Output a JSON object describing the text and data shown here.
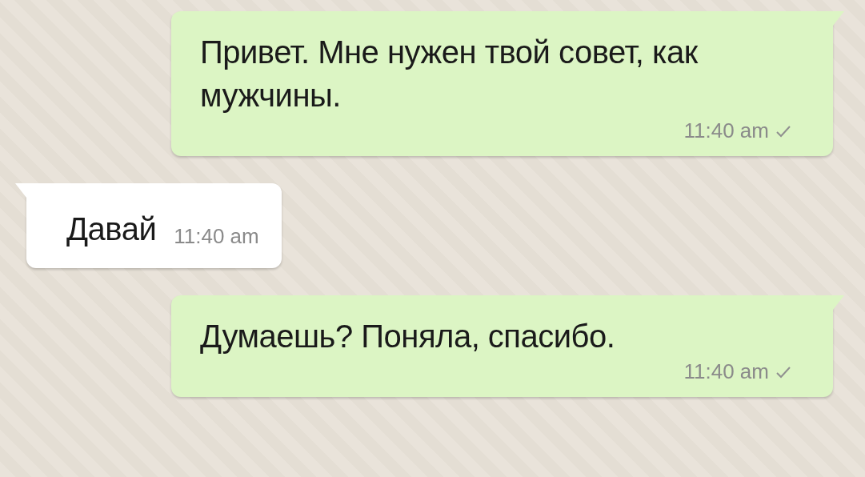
{
  "messages": [
    {
      "kind": "outgoing",
      "text": "Привет. Мне нужен твой совет, как мужчины.",
      "time": "11:40 am",
      "sent": true
    },
    {
      "kind": "incoming",
      "text": "Давай",
      "time": "11:40 am"
    },
    {
      "kind": "outgoing",
      "text": "Думаешь? Поняла, спасибо.",
      "time": "11:40 am",
      "sent": true
    }
  ]
}
